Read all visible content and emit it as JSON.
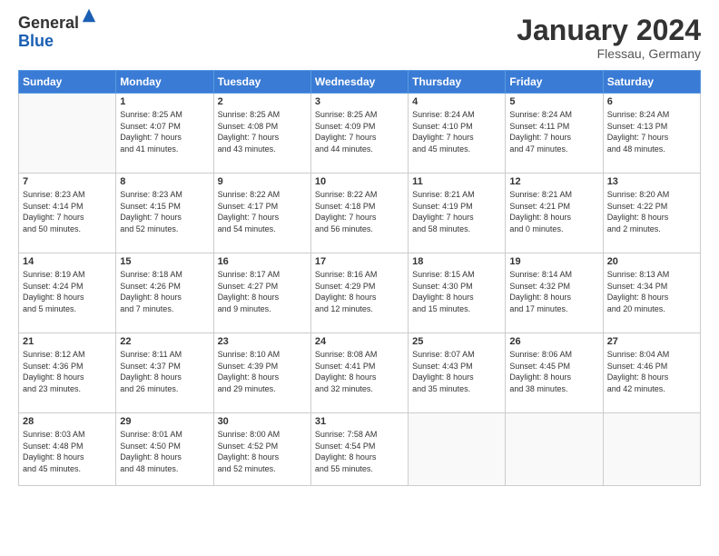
{
  "header": {
    "logo_general": "General",
    "logo_blue": "Blue",
    "month_title": "January 2024",
    "location": "Flessau, Germany"
  },
  "days_of_week": [
    "Sunday",
    "Monday",
    "Tuesday",
    "Wednesday",
    "Thursday",
    "Friday",
    "Saturday"
  ],
  "weeks": [
    [
      {
        "num": "",
        "info": ""
      },
      {
        "num": "1",
        "info": "Sunrise: 8:25 AM\nSunset: 4:07 PM\nDaylight: 7 hours\nand 41 minutes."
      },
      {
        "num": "2",
        "info": "Sunrise: 8:25 AM\nSunset: 4:08 PM\nDaylight: 7 hours\nand 43 minutes."
      },
      {
        "num": "3",
        "info": "Sunrise: 8:25 AM\nSunset: 4:09 PM\nDaylight: 7 hours\nand 44 minutes."
      },
      {
        "num": "4",
        "info": "Sunrise: 8:24 AM\nSunset: 4:10 PM\nDaylight: 7 hours\nand 45 minutes."
      },
      {
        "num": "5",
        "info": "Sunrise: 8:24 AM\nSunset: 4:11 PM\nDaylight: 7 hours\nand 47 minutes."
      },
      {
        "num": "6",
        "info": "Sunrise: 8:24 AM\nSunset: 4:13 PM\nDaylight: 7 hours\nand 48 minutes."
      }
    ],
    [
      {
        "num": "7",
        "info": "Sunrise: 8:23 AM\nSunset: 4:14 PM\nDaylight: 7 hours\nand 50 minutes."
      },
      {
        "num": "8",
        "info": "Sunrise: 8:23 AM\nSunset: 4:15 PM\nDaylight: 7 hours\nand 52 minutes."
      },
      {
        "num": "9",
        "info": "Sunrise: 8:22 AM\nSunset: 4:17 PM\nDaylight: 7 hours\nand 54 minutes."
      },
      {
        "num": "10",
        "info": "Sunrise: 8:22 AM\nSunset: 4:18 PM\nDaylight: 7 hours\nand 56 minutes."
      },
      {
        "num": "11",
        "info": "Sunrise: 8:21 AM\nSunset: 4:19 PM\nDaylight: 7 hours\nand 58 minutes."
      },
      {
        "num": "12",
        "info": "Sunrise: 8:21 AM\nSunset: 4:21 PM\nDaylight: 8 hours\nand 0 minutes."
      },
      {
        "num": "13",
        "info": "Sunrise: 8:20 AM\nSunset: 4:22 PM\nDaylight: 8 hours\nand 2 minutes."
      }
    ],
    [
      {
        "num": "14",
        "info": "Sunrise: 8:19 AM\nSunset: 4:24 PM\nDaylight: 8 hours\nand 5 minutes."
      },
      {
        "num": "15",
        "info": "Sunrise: 8:18 AM\nSunset: 4:26 PM\nDaylight: 8 hours\nand 7 minutes."
      },
      {
        "num": "16",
        "info": "Sunrise: 8:17 AM\nSunset: 4:27 PM\nDaylight: 8 hours\nand 9 minutes."
      },
      {
        "num": "17",
        "info": "Sunrise: 8:16 AM\nSunset: 4:29 PM\nDaylight: 8 hours\nand 12 minutes."
      },
      {
        "num": "18",
        "info": "Sunrise: 8:15 AM\nSunset: 4:30 PM\nDaylight: 8 hours\nand 15 minutes."
      },
      {
        "num": "19",
        "info": "Sunrise: 8:14 AM\nSunset: 4:32 PM\nDaylight: 8 hours\nand 17 minutes."
      },
      {
        "num": "20",
        "info": "Sunrise: 8:13 AM\nSunset: 4:34 PM\nDaylight: 8 hours\nand 20 minutes."
      }
    ],
    [
      {
        "num": "21",
        "info": "Sunrise: 8:12 AM\nSunset: 4:36 PM\nDaylight: 8 hours\nand 23 minutes."
      },
      {
        "num": "22",
        "info": "Sunrise: 8:11 AM\nSunset: 4:37 PM\nDaylight: 8 hours\nand 26 minutes."
      },
      {
        "num": "23",
        "info": "Sunrise: 8:10 AM\nSunset: 4:39 PM\nDaylight: 8 hours\nand 29 minutes."
      },
      {
        "num": "24",
        "info": "Sunrise: 8:08 AM\nSunset: 4:41 PM\nDaylight: 8 hours\nand 32 minutes."
      },
      {
        "num": "25",
        "info": "Sunrise: 8:07 AM\nSunset: 4:43 PM\nDaylight: 8 hours\nand 35 minutes."
      },
      {
        "num": "26",
        "info": "Sunrise: 8:06 AM\nSunset: 4:45 PM\nDaylight: 8 hours\nand 38 minutes."
      },
      {
        "num": "27",
        "info": "Sunrise: 8:04 AM\nSunset: 4:46 PM\nDaylight: 8 hours\nand 42 minutes."
      }
    ],
    [
      {
        "num": "28",
        "info": "Sunrise: 8:03 AM\nSunset: 4:48 PM\nDaylight: 8 hours\nand 45 minutes."
      },
      {
        "num": "29",
        "info": "Sunrise: 8:01 AM\nSunset: 4:50 PM\nDaylight: 8 hours\nand 48 minutes."
      },
      {
        "num": "30",
        "info": "Sunrise: 8:00 AM\nSunset: 4:52 PM\nDaylight: 8 hours\nand 52 minutes."
      },
      {
        "num": "31",
        "info": "Sunrise: 7:58 AM\nSunset: 4:54 PM\nDaylight: 8 hours\nand 55 minutes."
      },
      {
        "num": "",
        "info": ""
      },
      {
        "num": "",
        "info": ""
      },
      {
        "num": "",
        "info": ""
      }
    ]
  ]
}
